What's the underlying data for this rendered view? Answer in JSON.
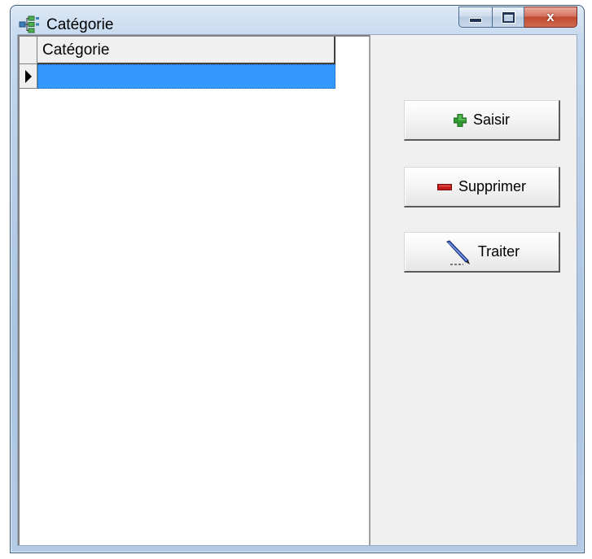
{
  "window": {
    "title": "Catégorie",
    "controls": {
      "minimize_icon": "minimize-icon",
      "maximize_icon": "maximize-icon",
      "close_icon": "close-icon",
      "close_glyph": "x"
    }
  },
  "grid": {
    "columns": [
      "Catégorie"
    ],
    "rows": [
      {
        "current": true,
        "selected": true,
        "values": [
          ""
        ]
      }
    ],
    "selection_color": "#3399ff"
  },
  "actions": {
    "saisir": {
      "label": "Saisir",
      "icon": "green-plus-icon",
      "color": "#2a8a2a"
    },
    "supprimer": {
      "label": "Supprimer",
      "icon": "red-minus-icon",
      "color": "#c01818"
    },
    "traiter": {
      "label": "Traiter",
      "icon": "pen-icon"
    }
  }
}
